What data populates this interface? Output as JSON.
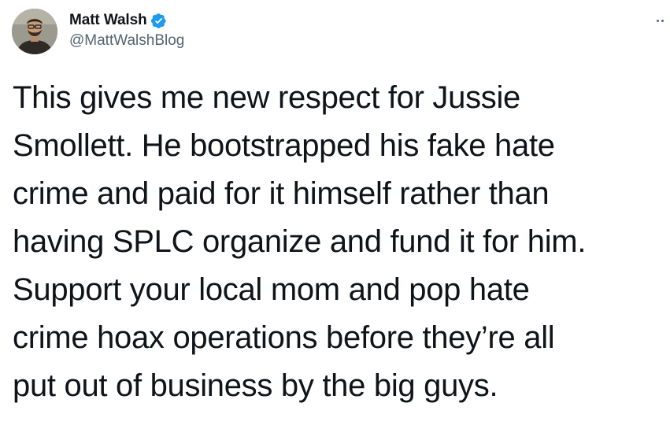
{
  "author": {
    "display_name": "Matt Walsh",
    "handle": "@MattWalshBlog",
    "verified": true,
    "verified_color": "#1d9bf0",
    "avatar_icon": "profile-photo"
  },
  "menu": {
    "icon": "more-options-icon"
  },
  "tweet": {
    "lines": [
      "This gives me new respect for Jussie",
      "Smollett. He bootstrapped his fake hate",
      "crime and paid for it himself rather than",
      "having SPLC organize and fund it for him.",
      "Support your local mom and pop hate",
      "crime hoax operations before they’re all",
      "put out of business by the big guys."
    ]
  }
}
